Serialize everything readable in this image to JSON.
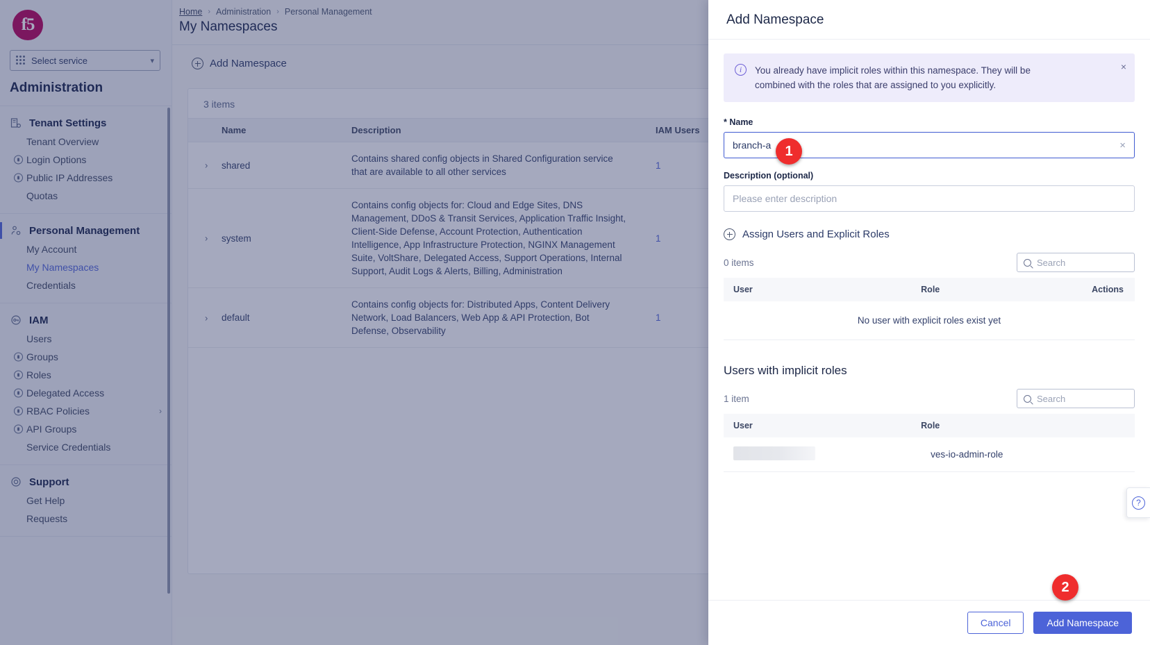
{
  "sidebar": {
    "logo": "f5",
    "service_select": {
      "label": "Select service",
      "icon": "grid-icon",
      "chevron": "chevron-down-icon"
    },
    "section_title": "Administration",
    "groups": [
      {
        "head": "Tenant Settings",
        "icon": "building-settings-icon",
        "active": false,
        "items": [
          {
            "label": "Tenant Overview",
            "lock": false,
            "current": false
          },
          {
            "label": "Login Options",
            "lock": true,
            "current": false
          },
          {
            "label": "Public IP Addresses",
            "lock": true,
            "current": false
          },
          {
            "label": "Quotas",
            "lock": false,
            "current": false
          }
        ]
      },
      {
        "head": "Personal Management",
        "icon": "user-settings-icon",
        "active": true,
        "items": [
          {
            "label": "My Account",
            "lock": false,
            "current": false
          },
          {
            "label": "My Namespaces",
            "lock": false,
            "current": true
          },
          {
            "label": "Credentials",
            "lock": false,
            "current": false
          }
        ]
      },
      {
        "head": "IAM",
        "icon": "key-icon",
        "active": false,
        "items": [
          {
            "label": "Users",
            "lock": false,
            "current": false
          },
          {
            "label": "Groups",
            "lock": true,
            "current": false
          },
          {
            "label": "Roles",
            "lock": true,
            "current": false
          },
          {
            "label": "Delegated Access",
            "lock": true,
            "current": false
          },
          {
            "label": "RBAC Policies",
            "lock": true,
            "current": false,
            "chevron": "›"
          },
          {
            "label": "API Groups",
            "lock": true,
            "current": false
          },
          {
            "label": "Service Credentials",
            "lock": false,
            "current": false
          }
        ]
      },
      {
        "head": "Support",
        "icon": "lifebuoy-icon",
        "active": false,
        "items": [
          {
            "label": "Get Help",
            "lock": false,
            "current": false
          },
          {
            "label": "Requests",
            "lock": false,
            "current": false
          }
        ]
      }
    ]
  },
  "main": {
    "breadcrumb": {
      "home": "Home",
      "level2": "Administration",
      "level3": "Personal Management",
      "sep": "›"
    },
    "page_title": "My Namespaces",
    "add_button": "Add Namespace",
    "item_count": "3 items",
    "table": {
      "headers": {
        "name": "Name",
        "description": "Description",
        "iam_users": "IAM Users"
      },
      "rows": [
        {
          "name": "shared",
          "description": "Contains shared config objects in Shared Configuration service that are available to all other services",
          "iam_users": "1"
        },
        {
          "name": "system",
          "description": "Contains config objects for: Cloud and Edge Sites, DNS Management, DDoS & Transit Services, Application Traffic Insight, Client-Side Defense, Account Protection, Authentication Intelligence, App Infrastructure Protection, NGINX Management Suite, VoltShare, Delegated Access, Support Operations, Internal Support, Audit Logs & Alerts, Billing, Administration",
          "iam_users": "1"
        },
        {
          "name": "default",
          "description": "Contains config objects for: Distributed Apps, Content Delivery Network, Load Balancers, Web App & API Protection, Bot Defense, Observability",
          "iam_users": "1"
        }
      ]
    }
  },
  "panel": {
    "title": "Add Namespace",
    "banner": {
      "text": "You already have implicit roles within this namespace. They will be combined with the roles that are assigned to you explicitly.",
      "icon": "info-icon",
      "close": "×"
    },
    "name_field": {
      "label": "* Name",
      "value": "branch-a",
      "clear": "×"
    },
    "description_field": {
      "label": "Description (optional)",
      "placeholder": "Please enter description",
      "value": ""
    },
    "assign_section": {
      "label": "Assign Users and Explicit Roles",
      "icon": "plus-circle-icon",
      "count": "0 items",
      "search_placeholder": "Search",
      "headers": {
        "user": "User",
        "role": "Role",
        "actions": "Actions"
      },
      "empty_text": "No user with explicit roles exist yet"
    },
    "implicit_section": {
      "title": "Users with implicit roles",
      "count": "1 item",
      "search_placeholder": "Search",
      "headers": {
        "user": "User",
        "role": "Role"
      },
      "rows": [
        {
          "user": "",
          "user_redacted": true,
          "role": "ves-io-admin-role"
        }
      ]
    },
    "footer": {
      "cancel": "Cancel",
      "submit": "Add Namespace"
    }
  },
  "annotations": {
    "step1": "1",
    "step2": "2"
  },
  "help": {
    "icon": "question-mark-icon"
  },
  "colors": {
    "accent_blue": "#4c63d8",
    "brand_magenta": "#b4005a",
    "badge_red": "#ef2d2d",
    "banner_bg": "#eeecfb"
  }
}
